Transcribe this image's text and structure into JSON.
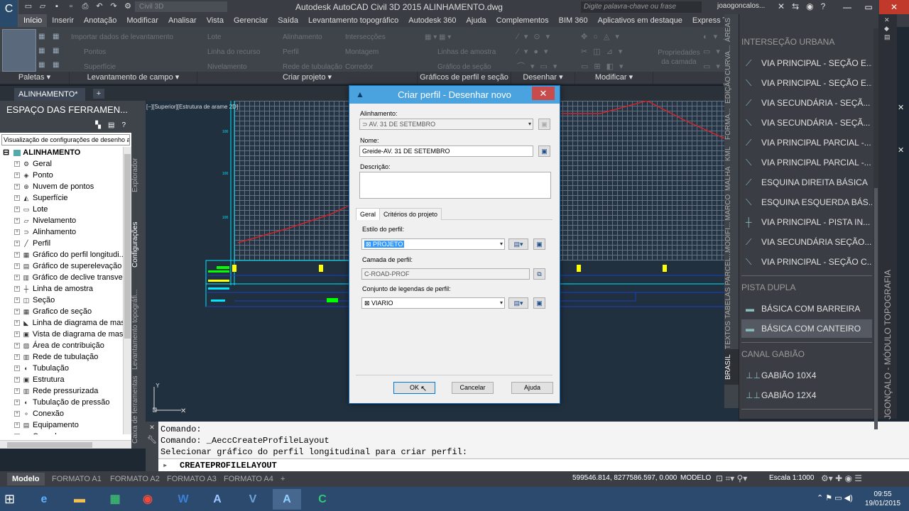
{
  "app": {
    "title": "Autodesk AutoCAD Civil 3D 2015    ALINHAMENTO.dwg",
    "workspace_placeholder": "Civil 3D",
    "search_placeholder": "Digite palavra-chave ou frase",
    "user": "joaogoncalos..."
  },
  "menu_tabs": [
    "Início",
    "Inserir",
    "Anotação",
    "Modificar",
    "Analisar",
    "Vista",
    "Gerenciar",
    "Saída",
    "Levantamento topográfico",
    "Autodesk 360",
    "Ajuda",
    "Complementos",
    "BIM 360",
    "Aplicativos em destaque",
    "Express Tools"
  ],
  "ribbon": {
    "col1": [
      "Importar dados de levantamento",
      "Pontos",
      "Superfície"
    ],
    "col2": [
      "Lote",
      "Linha do recurso",
      "Nivelamento"
    ],
    "col3": [
      "Alinhamento",
      "Perfil",
      "Rede de tubulação"
    ],
    "col4": [
      "Intersecções",
      "Montagem",
      "Corredor"
    ],
    "col5": [
      "Linhas de amostra",
      "Gráfico de seção"
    ],
    "col6": [
      "Propriedades da camada"
    ],
    "panels": [
      "Paletas",
      "Levantamento de campo",
      "Criar projeto",
      "Gráficos de perfil e seção",
      "Desenhar",
      "Modificar"
    ]
  },
  "doc_tab": "ALINHAMENTO*",
  "toolspace": {
    "title": "ESPAÇO DAS FERRAMEN...",
    "view_select": "Visualização de configurações de desenho a",
    "root": "ALINHAMENTO",
    "items": [
      "Geral",
      "Ponto",
      "Nuvem de pontos",
      "Superfície",
      "Lote",
      "Nivelamento",
      "Alinhamento",
      "Perfil",
      "Gráfico do perfil longitudi...",
      "Gráfico de superelevação",
      "Gráfico de declive transver...",
      "Linha de amostra",
      "Seção",
      "Grafico de seção",
      "Linha de diagrama de mas...",
      "Vista de diagrama de massa",
      "Área de contribuição",
      "Rede de tubulação",
      "Tubulação",
      "Estrutura",
      "Rede pressurizada",
      "Tubulação de pressão",
      "Conexão",
      "Equipamento",
      "Corredor"
    ],
    "vtabs": [
      "Explorador",
      "Configurações",
      "Levantamento topográfi...",
      "Caixa de ferramentas"
    ]
  },
  "drawing": {
    "viewport_label": "[−][Superior][Estrutura de arame 2D]"
  },
  "command": {
    "lines": [
      "Comando:",
      "Comando: _AeccCreateProfileLayout",
      "Selecionar gráfico do perfil longitudinal para criar perfil:"
    ],
    "prompt": "CREATEPROFILELAYOUT"
  },
  "dialog": {
    "title": "Criar perfil - Desenhar novo",
    "alinhamento_label": "Alinhamento:",
    "alinhamento_value": "AV. 31 DE SETEMBRO",
    "nome_label": "Nome:",
    "nome_value": "Greide-AV. 31 DE SETEMBRO",
    "descricao_label": "Descrição:",
    "tabs": [
      "Geral",
      "Critérios do projeto"
    ],
    "estilo_label": "Estilo do perfil:",
    "estilo_value": "PROJETO",
    "camada_label": "Camada de perfil:",
    "camada_value": "C-ROAD-PROF",
    "legendas_label": "Conjunto de legendas de perfil:",
    "legendas_value": "VIARIO",
    "ok": "OK",
    "cancel": "Cancelar",
    "help": "Ajuda"
  },
  "palette": {
    "title": "JGONÇALO - MÓDULO TOPOGRAFIA",
    "vtabs": [
      "ÁREAS",
      "CURVA...",
      "EDIÇÃO",
      "FORMA...",
      "KML",
      "MALHA",
      "MARCO",
      "MODIFI...",
      "PARCEL...",
      "TABELAS",
      "TEXTOS",
      "BRASIL"
    ],
    "sections": [
      {
        "title": "INTERSEÇÃO URBANA",
        "items": [
          "VIA PRINCIPAL - SEÇÃO E...",
          "VIA PRINCIPAL - SEÇÃO E...",
          "VIA SECUNDÁRIA - SEÇÃ...",
          "VIA SECUNDÁRIA - SEÇÃ...",
          "VIA PRINCIPAL PARCIAL -...",
          "VIA PRINCIPAL PARCIAL -...",
          "ESQUINA DIREITA BÁSICA",
          "ESQUINA ESQUERDA BÁS...",
          "VIA PRINCIPAL - PISTA IN...",
          "VIA SECUNDÁRIA SEÇÃO...",
          "VIA PRINCIPAL - SEÇÃO C..."
        ]
      },
      {
        "title": "PISTA DUPLA",
        "items": [
          "BÁSICA COM BARREIRA",
          "BÁSICA COM CANTEIRO"
        ]
      },
      {
        "title": "CANAL GABIÃO",
        "items": [
          "GABIÃO 10X4",
          "GABIÃO 12X4"
        ]
      }
    ]
  },
  "status": {
    "layout_tabs": [
      "Modelo",
      "FORMATO A1",
      "FORMATO A2",
      "FORMATO A3",
      "FORMATO A4"
    ],
    "coords": "599546.814, 8277586.597, 0.000",
    "model": "MODELO",
    "scale": "Escala 1:1000"
  },
  "taskbar": {
    "time": "09:55",
    "date": "19/01/2015"
  },
  "colors": {
    "accent": "#4aa3df",
    "profile_line": "#d2232a",
    "band_cyan": "#00e5ff",
    "band_yellow": "#ffff00"
  }
}
